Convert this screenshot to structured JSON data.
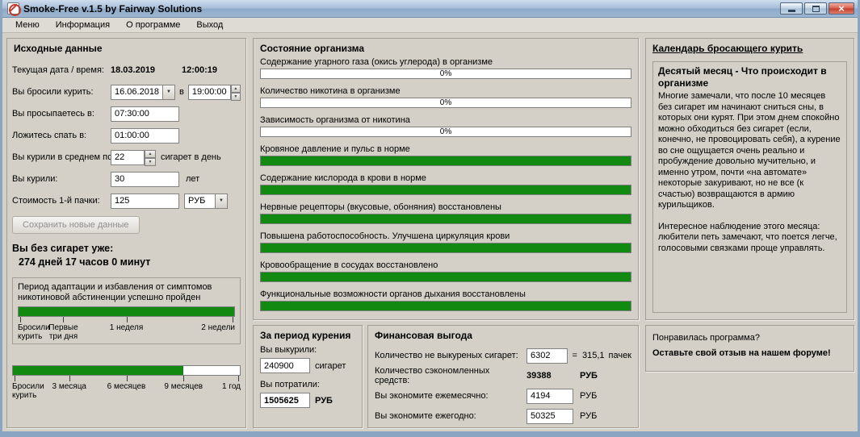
{
  "window": {
    "title": "Smoke-Free v.1.5 by Fairway Solutions"
  },
  "menu": {
    "items": [
      "Меню",
      "Информация",
      "О программе",
      "Выход"
    ]
  },
  "left": {
    "title": "Исходные данные",
    "rows": {
      "current": {
        "label": "Текущая дата / время:",
        "date": "18.03.2019",
        "time": "12:00:19"
      },
      "quit": {
        "label": "Вы бросили курить:",
        "date": "16.06.2018",
        "mid": "в",
        "time": "19:00:00"
      },
      "wake": {
        "label": "Вы просыпаетесь в:",
        "value": "07:30:00"
      },
      "sleep": {
        "label": "Ложитесь спать в:",
        "value": "01:00:00"
      },
      "avg": {
        "label": "Вы курили в среднем по:",
        "value": "22",
        "suffix": "сигарет в день"
      },
      "years": {
        "label": "Вы курили:",
        "value": "30",
        "suffix": "лет"
      },
      "cost": {
        "label": "Стоимость 1-й пачки:",
        "value": "125",
        "currency": "РУБ"
      }
    },
    "save_button": "Сохранить новые данные",
    "since": {
      "label": "Вы без сигарет уже:",
      "value": "274 дней  17 часов  0 минут"
    },
    "adaptation": {
      "text": "Период адаптации и избавления от симптомов никотиновой абстиненции успешно пройден",
      "progress": 100,
      "labels": [
        "Бросили\nкурить",
        "Первые\nтри дня",
        "1 неделя",
        "2 недели"
      ]
    },
    "first_year": {
      "progress": 75,
      "labels": [
        "Бросили\nкурить",
        "3 месяца",
        "6 месяцев",
        "9 месяцев",
        "1 год"
      ]
    }
  },
  "middle": {
    "title": "Состояние организма",
    "bars": [
      {
        "label": "Содержание угарного газа (окись углерода) в организме",
        "value": 0,
        "text": "0%"
      },
      {
        "label": "Количество никотина в организме",
        "value": 0,
        "text": "0%"
      },
      {
        "label": "Зависимость организма от никотина",
        "value": 0,
        "text": "0%"
      },
      {
        "label": "Кровяное давление и пульс в норме",
        "value": 100,
        "text": ""
      },
      {
        "label": "Содержание кислорода в крови в норме",
        "value": 100,
        "text": ""
      },
      {
        "label": "Нервные рецепторы (вкусовые, обоняния) восстановлены",
        "value": 100,
        "text": ""
      },
      {
        "label": "Повышена работоспособность. Улучшена циркуляция крови",
        "value": 100,
        "text": ""
      },
      {
        "label": "Кровообращение в сосудах восстановлено",
        "value": 100,
        "text": ""
      },
      {
        "label": "Функциональные возможности органов дыхания восстановлены",
        "value": 100,
        "text": ""
      }
    ]
  },
  "smoking_period": {
    "title": "За период курения",
    "smoked_label": "Вы выкурили:",
    "smoked_value": "240900",
    "smoked_unit": "сигарет",
    "spent_label": "Вы потратили:",
    "spent_value": "1505625",
    "spent_unit": "РУБ"
  },
  "financial": {
    "title": "Финансовая выгода",
    "rows": [
      {
        "label": "Количество не выкуреных сигарет:",
        "value": "6302",
        "eq": "=",
        "packs": "315,1",
        "unit": "пачек"
      },
      {
        "label": "Количество сэкономленных средств:",
        "value": "39388",
        "unit": "РУБ"
      },
      {
        "label": "Вы экономите ежемесячно:",
        "value": "4194",
        "unit": "РУБ"
      },
      {
        "label": "Вы экономите ежегодно:",
        "value": "50325",
        "unit": "РУБ"
      }
    ]
  },
  "calendar": {
    "title": "Календарь бросающего курить",
    "heading": "Десятый месяц - Что происходит в организме",
    "para1": "Многие замечали, что после 10 месяцев без сигарет им начинают сниться сны, в которых они курят. При этом днем спокойно можно обходиться без сигарет (если, конечно, не провоцировать себя), а курение во сне ощущается очень реально и пробуждение довольно мучительно, и именно утром, почти «на автомате» некоторые закуривают, но не все (к счастью) возвращаются в армию курильщиков.",
    "para2": "Интересное наблюдение этого месяца: любители петь замечают, что поется легче, голосовыми связками проще управлять."
  },
  "feedback": {
    "question": "Понравилась программа?",
    "cta": "Оставьте свой отзыв на нашем форуме!"
  }
}
